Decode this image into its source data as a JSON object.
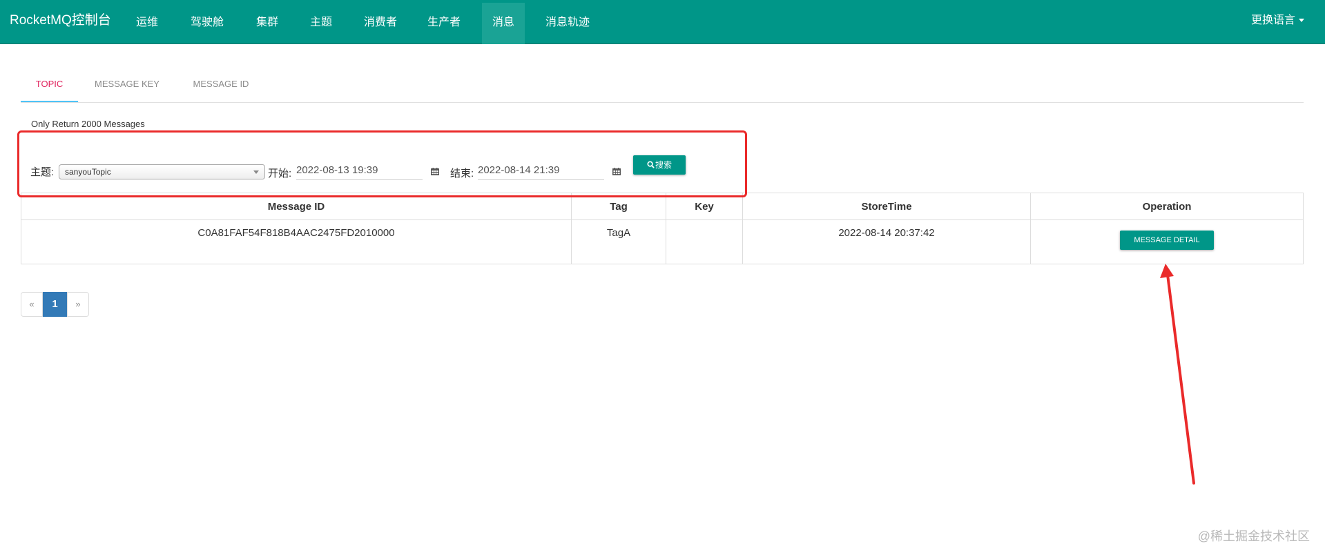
{
  "app": {
    "brand": "RocketMQ控制台",
    "language_switch": "更换语言"
  },
  "nav": {
    "items": [
      {
        "label": "运维"
      },
      {
        "label": "驾驶舱"
      },
      {
        "label": "集群"
      },
      {
        "label": "主题"
      },
      {
        "label": "消费者"
      },
      {
        "label": "生产者"
      },
      {
        "label": "消息",
        "active": true
      },
      {
        "label": "消息轨迹"
      }
    ]
  },
  "tabs": [
    {
      "label": "TOPIC",
      "active": true
    },
    {
      "label": "MESSAGE KEY"
    },
    {
      "label": "MESSAGE ID"
    }
  ],
  "search": {
    "notice": "Only Return 2000 Messages",
    "topic_label": "主题:",
    "topic_value": "sanyouTopic",
    "start_label": "开始:",
    "start_value": "2022-08-13 19:39",
    "end_label": "结束:",
    "end_value": "2022-08-14 21:39",
    "search_button": "搜索",
    "icons": {
      "search": "search-icon",
      "calendar": "calendar-icon"
    }
  },
  "table": {
    "columns": [
      "Message ID",
      "Tag",
      "Key",
      "StoreTime",
      "Operation"
    ],
    "rows": [
      {
        "message_id": "C0A81FAF54F818B4AAC2475FD2010000",
        "tag": "TagA",
        "key": "",
        "store_time": "2022-08-14 20:37:42",
        "action": "MESSAGE DETAIL"
      }
    ]
  },
  "pagination": {
    "prev": "«",
    "current": "1",
    "next": "»"
  },
  "colors": {
    "primary": "#009688",
    "active_tab_text": "#e0245e",
    "tab_underline": "#4fc3f7",
    "page_active": "#337ab7",
    "annotation_red": "#ea2a2a"
  },
  "watermark": "@稀土掘金技术社区"
}
